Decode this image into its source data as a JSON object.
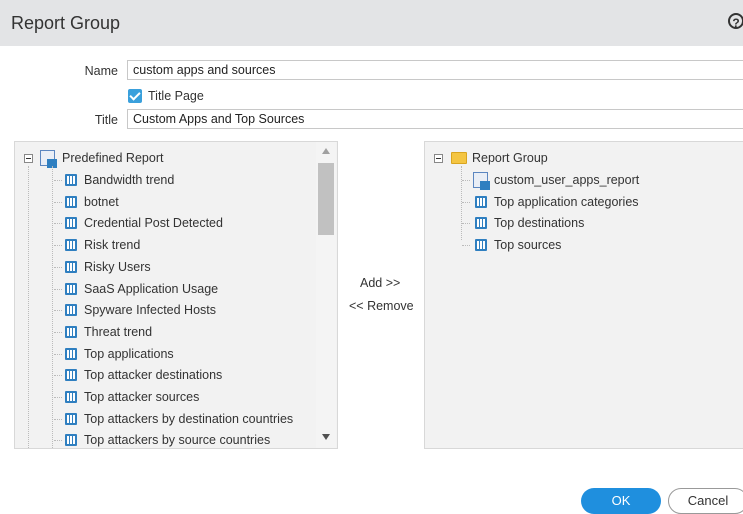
{
  "dialog": {
    "title": "Report Group",
    "help_icon": "?"
  },
  "form": {
    "name_label": "Name",
    "name_value": "custom apps and sources",
    "title_page_label": "Title Page",
    "title_page_checked": true,
    "title_label": "Title",
    "title_value": "Custom Apps and Top Sources"
  },
  "left_tree": {
    "root": "Predefined Report",
    "items": [
      "Bandwidth trend",
      "botnet",
      "Credential Post Detected",
      "Risk trend",
      "Risky Users",
      "SaaS Application Usage",
      "Spyware Infected Hosts",
      "Threat trend",
      "Top applications",
      "Top attacker destinations",
      "Top attacker sources",
      "Top attackers by destination countries",
      "Top attackers by source countries"
    ]
  },
  "transfer": {
    "add_label": "Add >>",
    "remove_label": "<< Remove"
  },
  "right_tree": {
    "root": "Report Group",
    "items": [
      "custom_user_apps_report",
      "Top application categories",
      "Top destinations",
      "Top sources"
    ]
  },
  "footer": {
    "ok_label": "OK",
    "cancel_label": "Cancel"
  },
  "colors": {
    "accent": "#1f8fde",
    "checkbox": "#3aa0dc",
    "titlebar": "#e3e4e6"
  }
}
